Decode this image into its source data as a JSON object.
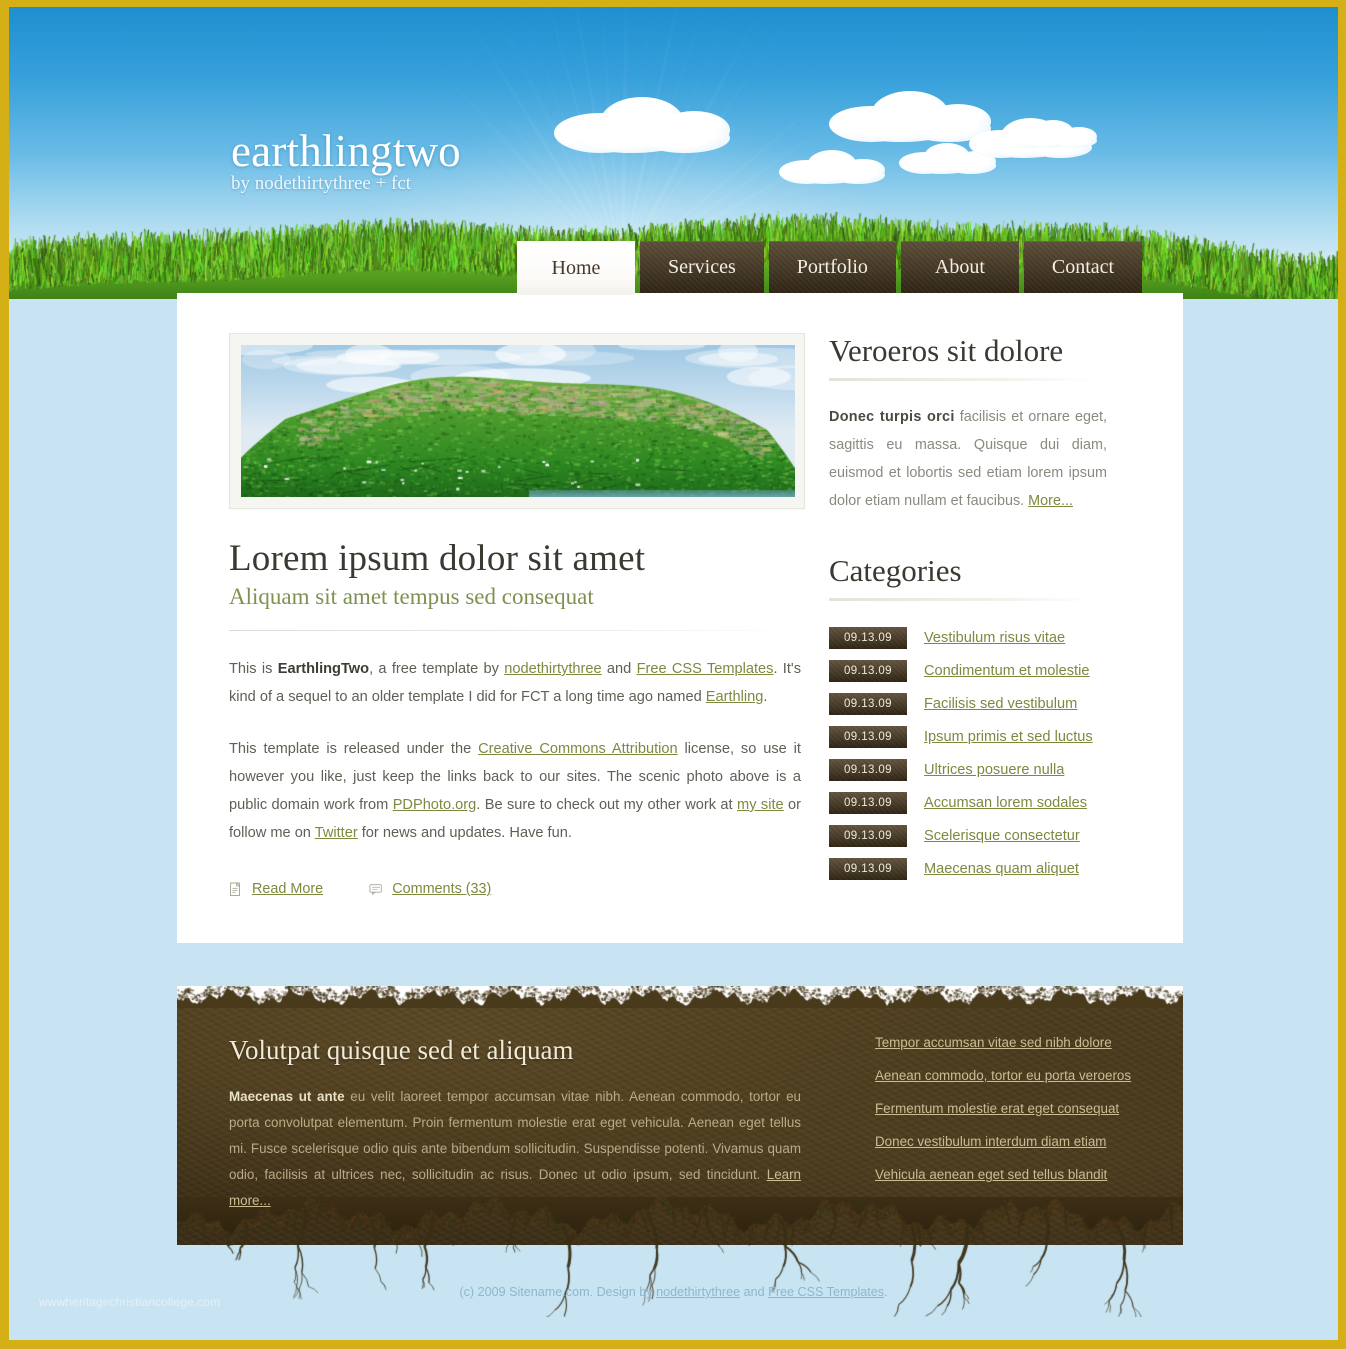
{
  "brand": {
    "title": "earthlingtwo",
    "tagline": "by nodethirtythree + fct"
  },
  "nav": [
    {
      "label": "Home",
      "active": true
    },
    {
      "label": "Services",
      "active": false
    },
    {
      "label": "Portfolio",
      "active": false
    },
    {
      "label": "About",
      "active": false
    },
    {
      "label": "Contact",
      "active": false
    }
  ],
  "main": {
    "hero_alt": "scenic green mountain plateau photo",
    "title": "Lorem ipsum dolor sit amet",
    "subtitle": "Aliquam sit amet tempus sed consequat",
    "p1": {
      "t1": "This is ",
      "b1": "EarthlingTwo",
      "t2": ", a free template by ",
      "l1": "nodethirtythree",
      "t3": " and ",
      "l2": "Free CSS Templates",
      "t4": ". It's kind of a sequel to an older template I did for FCT a long time ago named ",
      "l3": "Earthling",
      "t5": "."
    },
    "p2": {
      "t1": "This template is released under the ",
      "l1": "Creative Commons Attribution",
      "t2": " license, so use it however you like, just keep the links back to our sites. The scenic photo above is a public domain work from ",
      "l2": "PDPhoto.org",
      "t3": ". Be sure to check out my other work at ",
      "l3": "my site",
      "t4": " or follow me on ",
      "l4": "Twitter",
      "t5": " for news and updates. Have fun."
    },
    "read_more": "Read More",
    "comments": "Comments (33)"
  },
  "sidebar": {
    "box_title": "Veroeros sit dolore",
    "box_bold": "Donec turpis orci",
    "box_text": " facilisis et ornare eget, sagittis eu massa. Quisque dui diam, euismod et lobortis sed etiam lorem ipsum dolor etiam nullam et faucibus. ",
    "box_more": "More...",
    "cats_title": "Categories",
    "categories": [
      {
        "date": "09.13.09",
        "label": "Vestibulum risus vitae"
      },
      {
        "date": "09.13.09",
        "label": "Condimentum et molestie"
      },
      {
        "date": "09.13.09",
        "label": "Facilisis sed vestibulum"
      },
      {
        "date": "09.13.09",
        "label": "Ipsum primis et sed luctus"
      },
      {
        "date": "09.13.09",
        "label": "Ultrices posuere nulla"
      },
      {
        "date": "09.13.09",
        "label": "Accumsan lorem sodales"
      },
      {
        "date": "09.13.09",
        "label": "Scelerisque consectetur"
      },
      {
        "date": "09.13.09",
        "label": "Maecenas quam aliquet"
      }
    ]
  },
  "footer": {
    "title": "Volutpat quisque sed et aliquam",
    "bold": "Maecenas ut ante",
    "text": " eu velit laoreet tempor accumsan vitae nibh. Aenean commodo, tortor eu porta convolutpat elementum. Proin fermentum molestie erat eget vehicula. Aenean eget tellus mi. Fusce scelerisque odio quis ante bibendum sollicitudin. Suspendisse potenti. Vivamus quam odio, facilisis at ultrices nec, sollicitudin ac risus. Donec ut odio ipsum, sed tincidunt. ",
    "learn_more": "Learn more...",
    "links": [
      "Tempor accumsan vitae sed nibh dolore",
      "Aenean commodo, tortor eu porta veroeros",
      "Fermentum molestie erat eget consequat",
      "Donec vestibulum interdum diam etiam",
      "Vehicula aenean eget sed tellus blandit"
    ]
  },
  "copyright": {
    "t1": "(c) 2009 Sitename.com. Design by ",
    "l1": "nodethirtythree",
    "t2": " and ",
    "l2": "Free CSS Templates",
    "t3": "."
  },
  "watermark": "wwwheritagechristiancollege.com",
  "colors": {
    "frame": "#d4b016",
    "page_bg": "#c8e4f2",
    "sky_top": "#1f8fd0",
    "grass": "#6cbb2c",
    "dirt": "#443519",
    "link": "#7b8a3f",
    "nav_tab": "#3a2d19"
  }
}
